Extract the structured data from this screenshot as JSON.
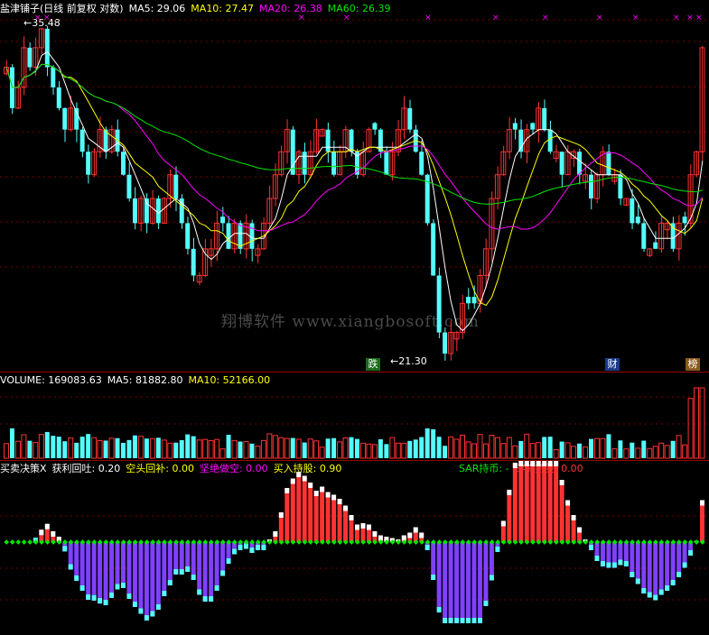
{
  "price_panel": {
    "title": "盐津铺子(日线 前复权 对数)",
    "ma5": "MA5: 29.06",
    "ma10": "MA10: 27.47",
    "ma20": "MA20: 26.38",
    "ma60": "MA60: 26.39",
    "high_label": "35.48",
    "low_label": "21.30",
    "tag_die": "跌",
    "tag_cai": "财",
    "tag_bang": "榜"
  },
  "volume_panel": {
    "volume": "VOLUME: 169083.63",
    "ma5": "MA5: 81882.80",
    "ma10": "MA10: 52166.00"
  },
  "indicator_panel": {
    "name": "买卖决策X",
    "profit": "获利回吐: 0.20",
    "cover": "空头回补: 0.00",
    "short": "坚绝做空: 0.00",
    "buy": "买入持股: 0.90",
    "sar_coin": "SAR持币: -",
    "sar_hold": "SAR持股: 0.00"
  },
  "watermark": "翔博软件 www.xiangbosoft.com",
  "colors": {
    "up": "#ff3232",
    "down": "#54fcfc",
    "ma5": "#ffffff",
    "ma10": "#ffff00",
    "ma20": "#ff00ff",
    "ma60": "#00e600",
    "neg_bar": "#8040ff",
    "diamond": "#00e600"
  },
  "chart_data": {
    "type": "candlestick",
    "title": "盐津铺子(日线 前复权 对数)",
    "high": 35.48,
    "low": 21.3,
    "close_path": [
      33,
      31,
      32,
      34,
      33,
      34,
      35,
      33,
      32,
      31,
      30,
      31,
      30,
      29,
      28,
      29,
      30,
      29,
      30,
      29,
      28,
      27,
      26,
      27,
      26,
      27,
      26,
      27,
      28,
      27,
      26,
      25,
      24,
      24,
      25,
      25,
      26,
      26,
      25,
      26,
      25,
      26,
      25,
      25,
      26,
      27,
      28,
      29,
      30,
      28,
      29,
      28,
      29,
      30,
      30,
      29,
      28,
      29,
      30,
      29,
      28,
      29,
      30,
      30,
      29,
      28,
      29,
      30,
      31,
      30,
      29,
      28,
      26,
      24,
      22,
      21.3,
      22,
      22,
      23,
      23,
      23,
      24,
      25,
      27,
      28,
      29,
      30,
      30,
      29,
      30,
      30,
      31,
      30,
      29,
      29,
      28,
      29,
      29,
      28,
      28,
      27,
      28,
      29,
      28,
      28,
      27,
      27,
      26,
      26,
      25,
      25,
      25,
      26,
      26,
      25,
      26,
      26,
      28,
      29,
      34
    ],
    "panels": [
      "price",
      "volume",
      "indicator"
    ]
  }
}
